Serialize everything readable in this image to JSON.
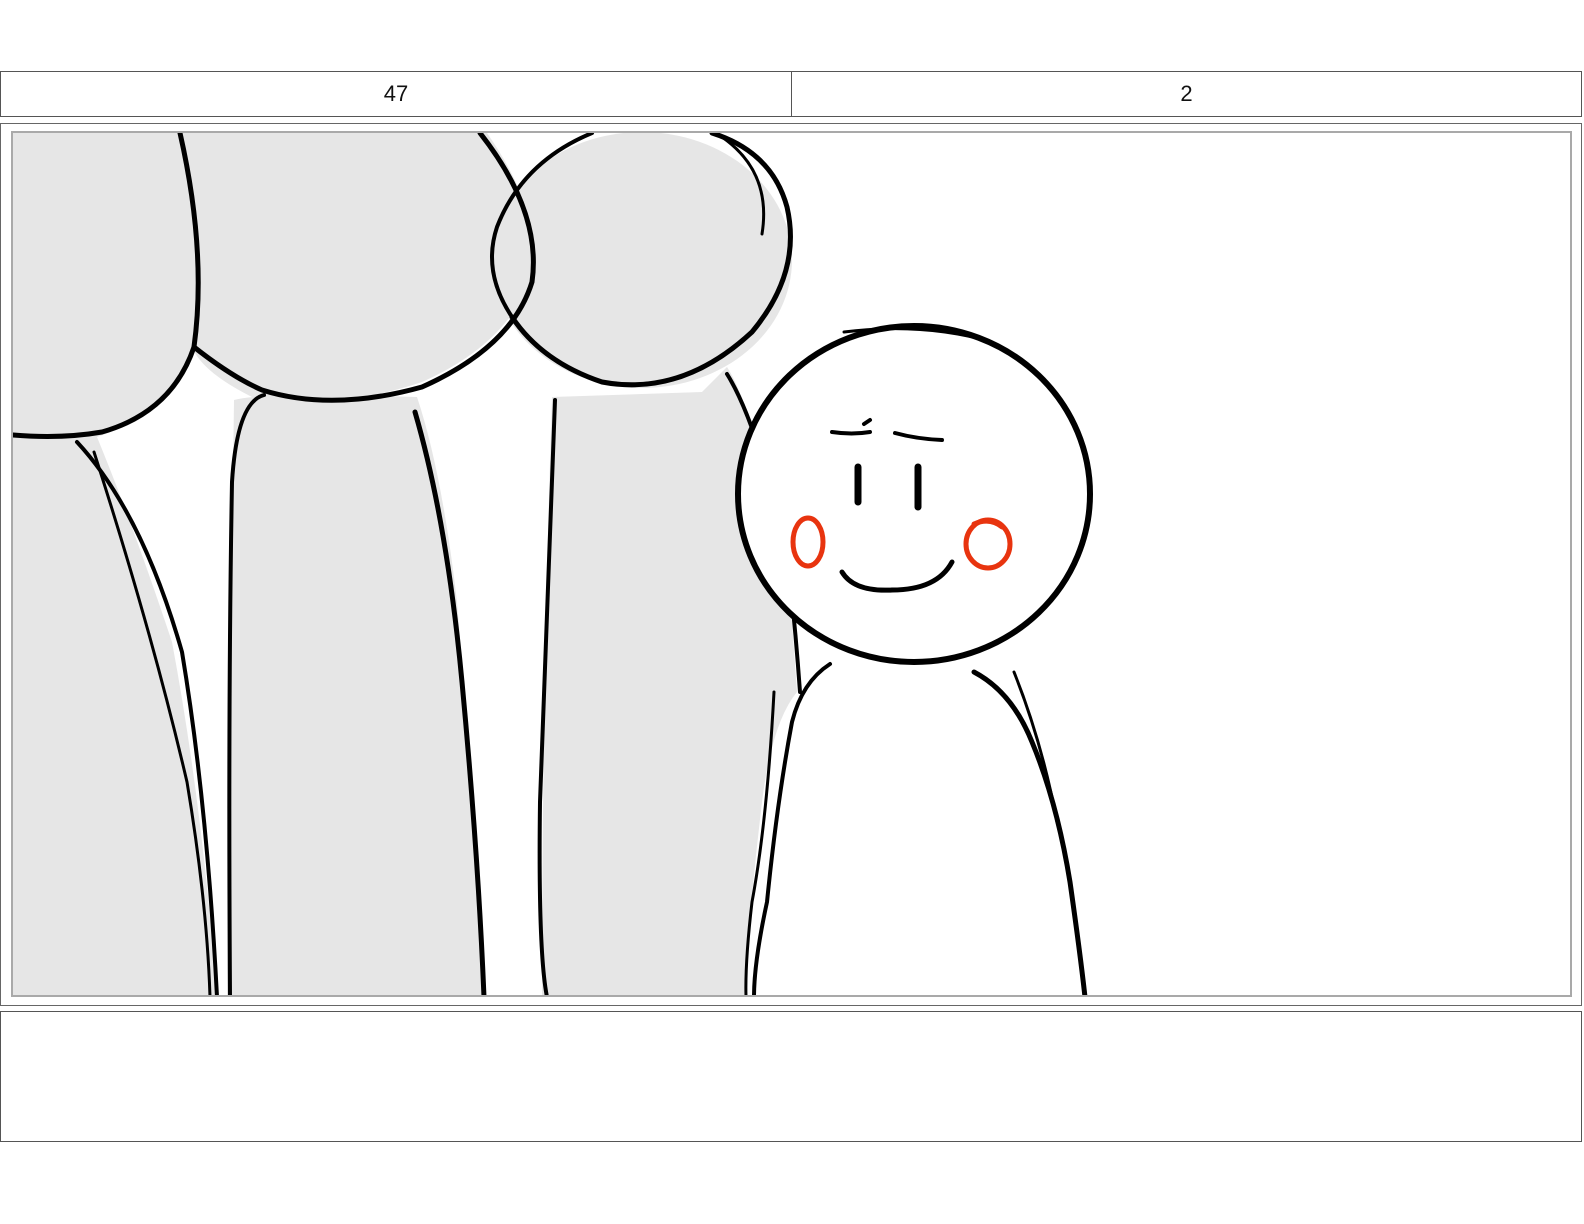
{
  "storyboard": {
    "scene_number": "47",
    "panel_number": "2",
    "notes": ""
  },
  "colors": {
    "sketch_line": "#000000",
    "background_figure_fill": "#e6e6e6",
    "blush": "#e8340f",
    "frame_border": "#a9a9a9"
  },
  "panel": {
    "background_figures": [
      "silhouette-figure",
      "silhouette-figure",
      "silhouette-figure",
      "silhouette-figure"
    ],
    "main_character": "smiling-stick-figure"
  }
}
